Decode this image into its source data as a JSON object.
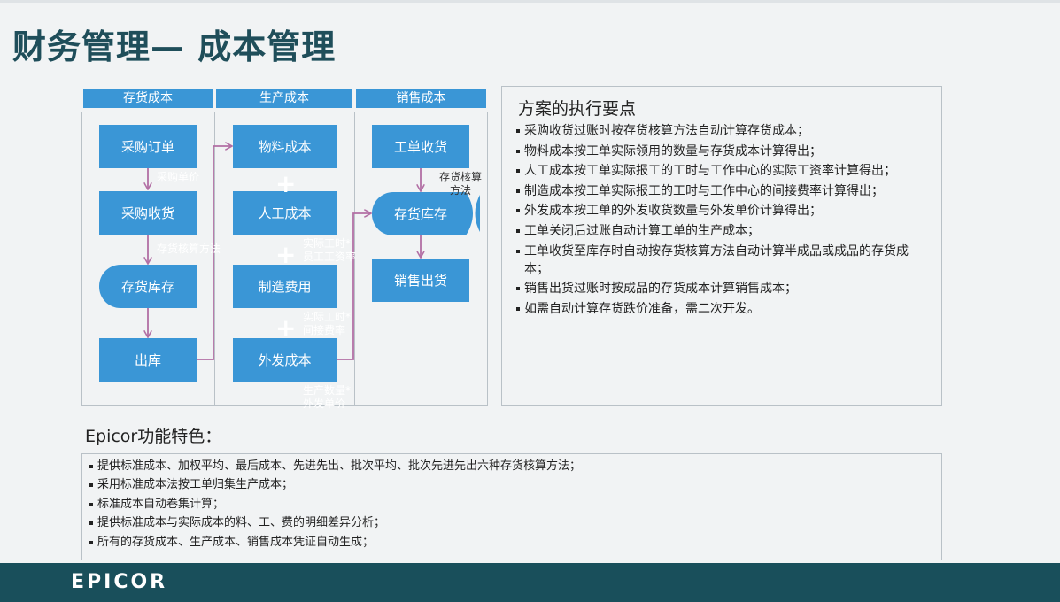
{
  "title": "财务管理— 成本管理",
  "columns": [
    {
      "header": "存货成本"
    },
    {
      "header": "生产成本"
    },
    {
      "header": "销售成本"
    }
  ],
  "nodes": {
    "purchase_order": "采购订单",
    "purchase_receipt": "采购收货",
    "inventory_1": "存货库存",
    "issue": "出库",
    "material_cost": "物料成本",
    "labor_cost": "人工成本",
    "manufacturing_cost": "制造费用",
    "outsourcing_cost": "外发成本",
    "wo_receipt": "工单收货",
    "inventory_2": "存货库存",
    "sales_shipment": "销售出货"
  },
  "edge_labels": {
    "purchase_price": "采购单价",
    "valuation_method": "存货核算方法",
    "labor_rate": "实际工时*\n员工工资率",
    "overhead_rate": "实际工时*\n间接费率",
    "outsource_price": "生产数量*\n外发单价",
    "valuation_method_2": "存货核算\n方法"
  },
  "plus_sign": "+",
  "panel": {
    "title": "方案的执行要点",
    "items": [
      "采购收货过账时按存货核算方法自动计算存货成本；",
      "物料成本按工单实际领用的数量与存货成本计算得出；",
      "人工成本按工单实际报工的工时与工作中心的实际工资率计算得出；",
      "制造成本按工单实际报工的工时与工作中心的间接费率计算得出；",
      "外发成本按工单的外发收货数量与外发单价计算得出；",
      "工单关闭后过账自动计算工单的生产成本；",
      "工单收货至库存时自动按存货核算方法自动计算半成品或成品的存货成本；",
      "销售出货过账时按成品的存货成本计算销售成本；",
      "如需自动计算存货跌价准备，需二次开发。"
    ]
  },
  "features": {
    "title": "Epicor功能特色：",
    "items": [
      "提供标准成本、加权平均、最后成本、先进先出、批次平均、批次先进先出六种存货核算方法；",
      "采用标准成本法按工单归集生产成本；",
      "标准成本自动卷集计算；",
      "提供标准成本与实际成本的料、工、费的明细差异分析；",
      "所有的存货成本、生产成本、销售成本凭证自动生成；"
    ]
  },
  "footer": {
    "logo": "EPICOR"
  },
  "colors": {
    "title": "#1f4e5a",
    "box": "#3a96d6",
    "connector": "#b26fa4",
    "footer": "#194f5b",
    "border": "#b9c1c7"
  }
}
